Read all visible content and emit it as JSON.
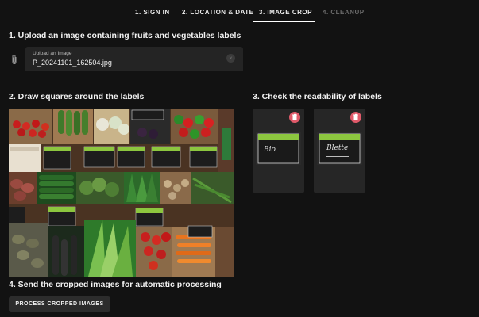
{
  "stepper": {
    "steps": [
      {
        "label": "1. SIGN IN",
        "state": "done"
      },
      {
        "label": "2. LOCATION & DATE",
        "state": "done"
      },
      {
        "label": "3. IMAGE CROP",
        "state": "active"
      },
      {
        "label": "4. CLEANUP",
        "state": "disabled"
      }
    ]
  },
  "upload": {
    "heading": "1. Upload an image containing fruits and vegetables labels",
    "field_label": "Upload an Image",
    "file_name": "P_20241101_162504.jpg",
    "attach_icon": "paperclip-icon",
    "clear_icon": "close-circle-icon"
  },
  "draw": {
    "heading": "2. Draw squares around the labels"
  },
  "check": {
    "heading": "3. Check the readability of labels",
    "crops": [
      {
        "delete_icon": "trash-icon",
        "label_text": "Bio"
      },
      {
        "delete_icon": "trash-icon",
        "label_text": "Blette"
      }
    ]
  },
  "send": {
    "heading": "4. Send the cropped images for automatic processing",
    "button_label": "PROCESS CROPPED IMAGES"
  },
  "colors": {
    "background": "#121212",
    "field_bg": "#242424",
    "card_bg": "#262626",
    "delete_accent": "#e05a6a",
    "button_bg": "#2c2c2c"
  }
}
